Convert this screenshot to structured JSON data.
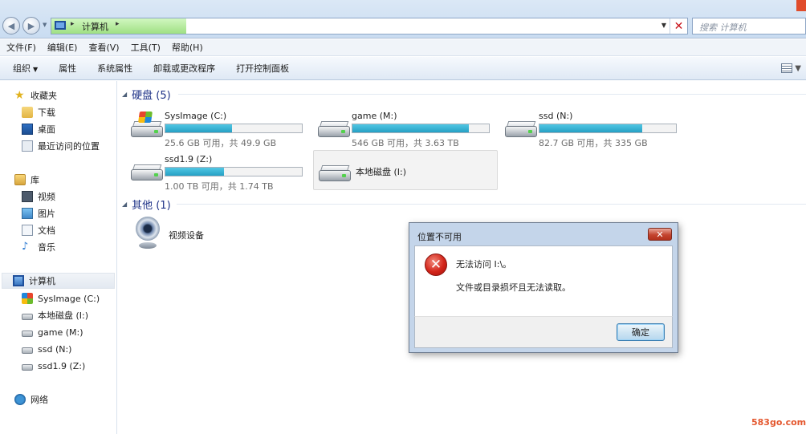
{
  "address_bar": {
    "location": "计算机",
    "search_placeholder": "搜索 计算机"
  },
  "menu": [
    "文件(F)",
    "编辑(E)",
    "查看(V)",
    "工具(T)",
    "帮助(H)"
  ],
  "command_bar": {
    "organize": "组织",
    "items": [
      "属性",
      "系统属性",
      "卸载或更改程序",
      "打开控制面板"
    ]
  },
  "nav": {
    "favorites": "收藏夹",
    "favorites_items": [
      "下载",
      "桌面",
      "最近访问的位置"
    ],
    "libraries": "库",
    "libraries_items": [
      "视频",
      "图片",
      "文档",
      "音乐"
    ],
    "computer": "计算机",
    "computer_items": [
      "SysImage (C:)",
      "本地磁盘 (I:)",
      "game (M:)",
      "ssd (N:)",
      "ssd1.9 (Z:)"
    ],
    "network": "网络"
  },
  "sections": {
    "hard_disks": "硬盘 (5)",
    "other": "其他 (1)"
  },
  "drives": [
    {
      "name": "SysImage (C:)",
      "info": "25.6 GB 可用，共 49.9 GB",
      "used_fraction": 0.49
    },
    {
      "name": "game (M:)",
      "info": "546 GB 可用，共 3.63 TB",
      "used_fraction": 0.85
    },
    {
      "name": "ssd (N:)",
      "info": "82.7 GB 可用，共 335 GB",
      "used_fraction": 0.75
    },
    {
      "name": "ssd1.9 (Z:)",
      "info": "1.00 TB 可用，共 1.74 TB",
      "used_fraction": 0.43
    },
    {
      "name": "本地磁盘 (I:)"
    }
  ],
  "other_devices": [
    {
      "name": "视频设备"
    }
  ],
  "dialog": {
    "title": "位置不可用",
    "message": "无法访问 I:\\。",
    "detail": "文件或目录损坏且无法读取。",
    "ok": "确定"
  },
  "watermark": "583go.com",
  "colors": {
    "bar_fill": "#26a0c4",
    "error_red": "#d3251a",
    "section_header": "#1e3287"
  }
}
